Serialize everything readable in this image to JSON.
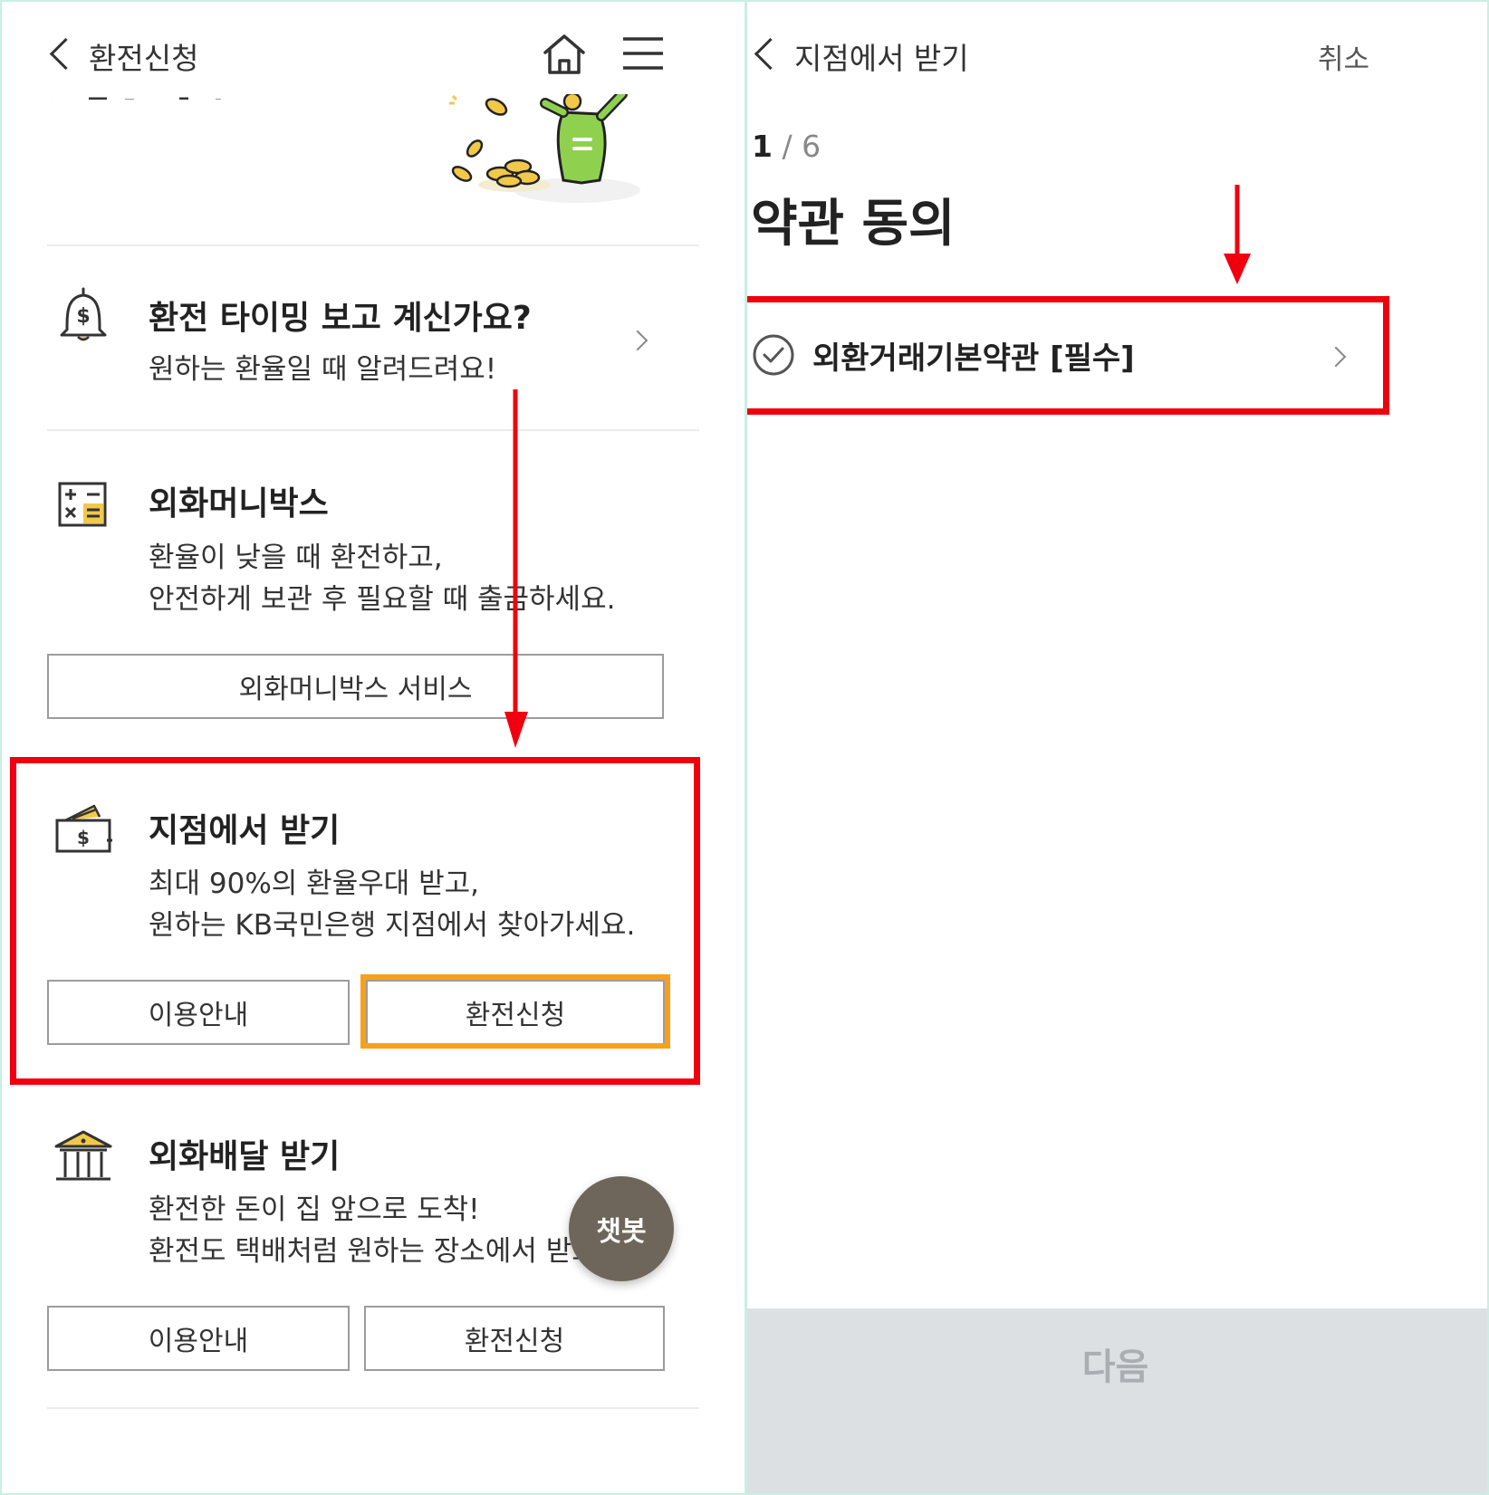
{
  "left": {
    "header": {
      "title": "환전신청"
    },
    "timing": {
      "title": "환전 타이밍 보고 계신가요?",
      "desc": "원하는 환율일 때 알려드려요!"
    },
    "moneybox": {
      "title": "외화머니박스",
      "desc1": "환율이 낮을 때 환전하고,",
      "desc2": "안전하게 보관 후 필요할 때 출금하세요.",
      "button": "외화머니박스 서비스"
    },
    "branch": {
      "title": "지점에서 받기",
      "desc1": "최대 90%의 환율우대 받고,",
      "desc2": "원하는 KB국민은행 지점에서 찾아가세요.",
      "info_button": "이용안내",
      "apply_button": "환전신청"
    },
    "delivery": {
      "title": "외화배달 받기",
      "desc1": "환전한 돈이 집 앞으로 도착!",
      "desc2": "환전도 택배처럼 원하는 장소에서 받으",
      "info_button": "이용안내",
      "apply_button": "환전신청"
    },
    "chatbot": "챗봇"
  },
  "right": {
    "header": {
      "title": "지점에서 받기",
      "cancel": "취소"
    },
    "step": {
      "current": "1",
      "total": "6"
    },
    "heading": "약관 동의",
    "terms_item": "외환거래기본약관 [필수]",
    "next_button": "다음"
  },
  "colors": {
    "highlight_red": "#f0000f",
    "highlight_orange": "#f9a01b",
    "chatbot_bg": "#6f665b",
    "next_bar_bg": "#dde0e3"
  }
}
